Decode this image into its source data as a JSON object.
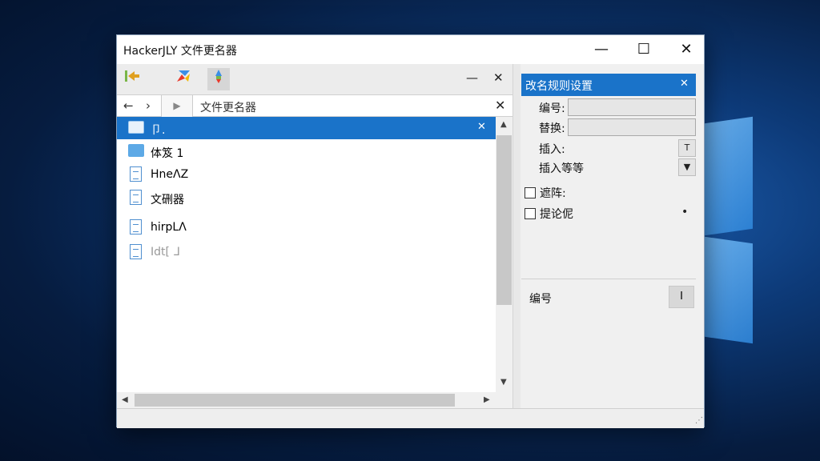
{
  "window": {
    "title": "HackerJLY 文件更名器",
    "minimize": "—",
    "maximize": "☐",
    "close": "✕"
  },
  "toolbar": {
    "minimize": "—",
    "close": "✕"
  },
  "address": {
    "back": "←",
    "forward": "›",
    "play": "▶",
    "path": "文件更名器",
    "clear": "✕"
  },
  "files": [
    {
      "label": "卩.",
      "type": "folder",
      "selected": true,
      "close": "✕"
    },
    {
      "label": "体笈 1",
      "type": "folder",
      "selected": false
    },
    {
      "label": "HneΛZ",
      "type": "doc",
      "selected": false
    },
    {
      "label": "文硎器",
      "type": "doc",
      "selected": false
    },
    {
      "label": "hirpLΛ",
      "type": "doc",
      "selected": false
    },
    {
      "label": "Idt[ ᒧ",
      "type": "doc",
      "selected": false
    }
  ],
  "scroll": {
    "up": "▲",
    "down": "▼",
    "left": "◀",
    "right": "▶"
  },
  "rules": {
    "header": "改名规则设置",
    "header_close": "✕",
    "number_label": "编号:",
    "replace_label": "替换:",
    "insert_label": "插入:",
    "insert_more_label": "插入等等",
    "insert_drop": "T",
    "insert_more_drop": "▼",
    "option1_label": "遮阵:",
    "option2_label": "提论伲",
    "option2_dot": "•",
    "bottom_label": "编号",
    "bottom_button": "I"
  },
  "grip": "⋰"
}
